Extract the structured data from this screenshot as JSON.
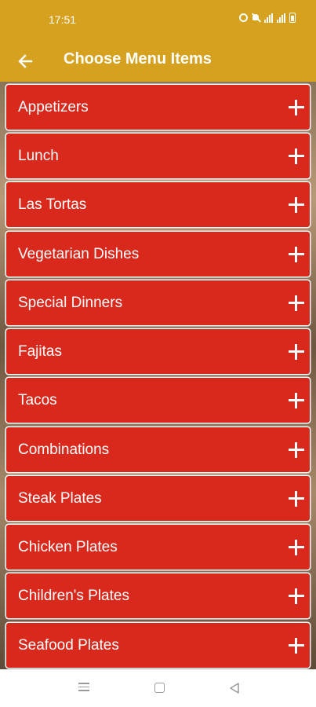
{
  "status_bar": {
    "time": "17:51",
    "icons": [
      "alarm-icon",
      "mute-icon",
      "signal-icon",
      "signal-icon",
      "battery-icon"
    ]
  },
  "app_bar": {
    "title": "Choose Menu Items",
    "back_icon": "arrow-left-icon",
    "color": "#d6a11e"
  },
  "menu": {
    "item_color": "#d9291c",
    "items": [
      {
        "label": "Appetizers"
      },
      {
        "label": "Lunch"
      },
      {
        "label": "Las Tortas"
      },
      {
        "label": "Vegetarian Dishes"
      },
      {
        "label": "Special Dinners"
      },
      {
        "label": "Fajitas"
      },
      {
        "label": "Tacos"
      },
      {
        "label": "Combinations"
      },
      {
        "label": "Steak Plates"
      },
      {
        "label": "Chicken Plates"
      },
      {
        "label": "Children's Plates"
      },
      {
        "label": "Seafood Plates"
      }
    ]
  },
  "nav_bar": {
    "icons": [
      "menu-icon",
      "home-icon",
      "back-triangle-icon"
    ]
  }
}
